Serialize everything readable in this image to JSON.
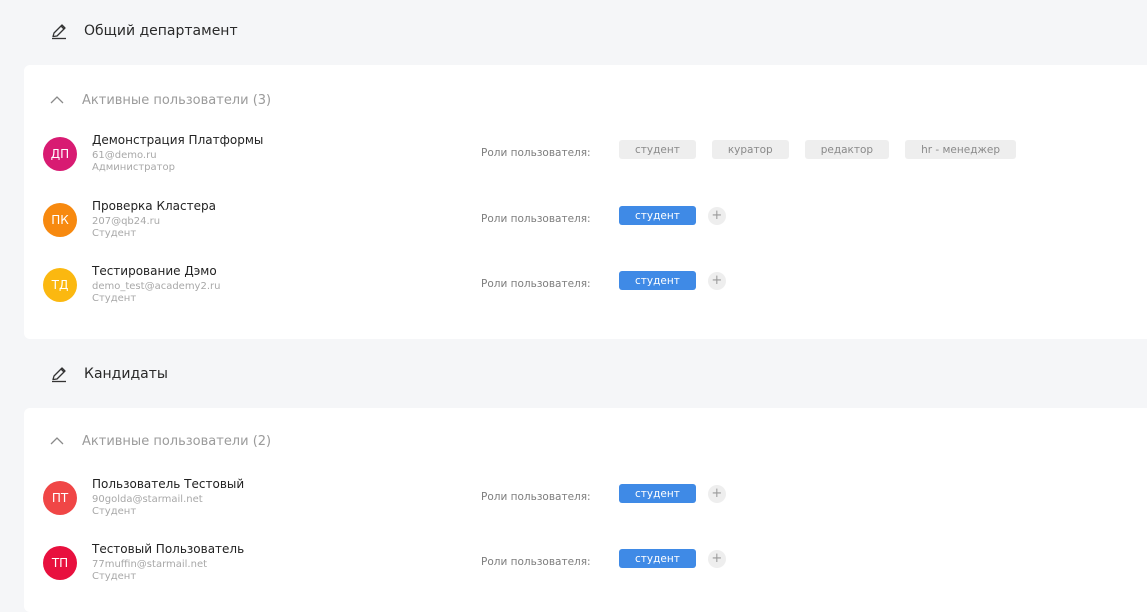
{
  "departments": [
    {
      "title": "Общий департамент",
      "group_title": "Активные пользователи (3)",
      "users": [
        {
          "initials": "ДП",
          "avatar_color": "#d81b72",
          "name": "Демонстрация Платформы",
          "email": "61@demo.ru",
          "role": "Администратор",
          "roles_label": "Роли пользователя:",
          "chips": [
            "студент",
            "куратор",
            "редактор",
            "hr - менеджер"
          ]
        },
        {
          "initials": "ПК",
          "avatar_color": "#f7890f",
          "name": "Проверка Кластера",
          "email": "207@qb24.ru",
          "role": "Студент",
          "roles_label": "Роли пользователя:",
          "chip": "студент",
          "add": "+"
        },
        {
          "initials": "ТД",
          "avatar_color": "#fbb810",
          "name": "Тестирование Дэмо",
          "email": "demo_test@academy2.ru",
          "role": "Студент",
          "roles_label": "Роли пользователя:",
          "chip": "студент",
          "add": "+"
        }
      ]
    },
    {
      "title": "Кандидаты",
      "group_title": "Активные пользователи (2)",
      "users": [
        {
          "initials": "ПТ",
          "avatar_color": "#f04646",
          "name": "Пользователь Тестовый",
          "email": "90golda@starmail.net",
          "role": "Студент",
          "roles_label": "Роли пользователя:",
          "chip": "студент",
          "add": "+"
        },
        {
          "initials": "ТП",
          "avatar_color": "#e8103e",
          "name": "Тестовый Пользователь",
          "email": "77muffin@starmail.net",
          "role": "Студент",
          "roles_label": "Роли пользователя:",
          "chip": "студент",
          "add": "+"
        }
      ]
    }
  ],
  "icons": {
    "pencil": "pencil-icon",
    "chevron": "chevron-up-icon"
  },
  "colors": {
    "accent": "#3f8ae6",
    "chip_inactive": "#eeeeee"
  }
}
